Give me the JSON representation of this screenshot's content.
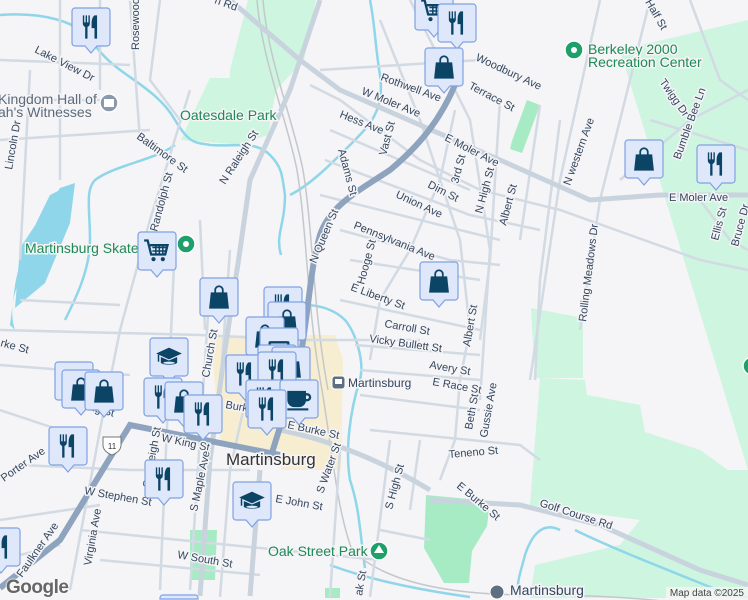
{
  "map": {
    "attribution": "Map data ©2025",
    "logo": "Google",
    "route_shield": "11",
    "colors": {
      "marker_fill": "#dfe8fb",
      "marker_border": "#7ea1e2",
      "marker_icon": "#0c4466",
      "park": "#cdf5df",
      "park_dark": "#a6ebc4",
      "water": "#8fd6ea",
      "highway": "#8ea3bd",
      "downtown": "#f7ecc9"
    },
    "places": {
      "city": "Martinsburg",
      "station": "Martinsburg",
      "station_bottom": "Martinsburg",
      "oatesdale_park": "Oatesdale Park",
      "skate": "Martinsburg Skate",
      "kingdom_hall_1": "Kingdom Hall of",
      "kingdom_hall_2": "ah's Witnesses",
      "berkeley_1": "Berkeley 2000",
      "berkeley_2": "Recreation Center",
      "oak_street_park": "Oak Street Park"
    },
    "streets": {
      "lake_view": "Lake View Dr",
      "rosewood": "Rosewood",
      "n_rd": "n Rd",
      "lincoln": "Lincoln Dr",
      "baltimore": "Baltimore St",
      "randolph": "Randolph St",
      "n_raleigh": "N Raleigh St",
      "w_moler": "W Moler Ave",
      "hess": "Hess Ave",
      "adams": "Adams St",
      "vast": "Vast St",
      "n_queen": "N Queen St",
      "rothwell": "Rothwell Ave",
      "woodbury": "Woodbury Ave",
      "terrace": "Terrace St",
      "e_moler": "E Moler Ave",
      "dim": "Dim St",
      "third": "3rd St",
      "n_high": "N High St",
      "albert": "Albert St",
      "union": "Union Ave",
      "pennsylvania": "Pennsylvania Ave",
      "hooge": "Hooge St",
      "e_liberty": "E Liberty St",
      "carroll": "Carroll St",
      "vicky": "Vicky Bullett St",
      "albert2": "Albert St",
      "avery": "Avery St",
      "e_race": "E Race St",
      "beth": "Beth St",
      "gussie": "Gussie Ave",
      "teneno": "Teneno St",
      "s_high": "S High St",
      "e_burke": "E Burke St",
      "golf": "Golf Course Rd",
      "rolling": "Rolling Meadows Dr",
      "n_western": "N western Ave",
      "twigg": "Twigg Dr",
      "bumble": "Bumble Bee Ln",
      "e_moler2": "E Moler Ave",
      "ellis": "Ellis St",
      "bruce": "Bruce Dr",
      "half": "Half St",
      "w_king": "W King St",
      "w_king2": "W King St",
      "e_burke2": "E Burke St",
      "burke": "Burke",
      "s_raleigh": "S Raleigh St",
      "s_maple": "S Maple Ave",
      "s_water": "S Water St",
      "w_stephen": "W Stephen St",
      "e_john": "E John St",
      "w_south": "W South St",
      "virginia": "Virginia Ave",
      "faulkner": "Faulkner Ave",
      "porter": "Porter Ave",
      "church": "Church St",
      "rke": "rke St",
      "ak": "ak St"
    },
    "markers": [
      "restaurant",
      "shopping-cart",
      "restaurant",
      "shopping-bag",
      "shopping-cart",
      "shopping-bag",
      "shopping-bag",
      "shopping-bag",
      "restaurant",
      "restaurant",
      "shopping-bag",
      "shopping-bag",
      "ticket",
      "shopping-bag",
      "shopping-bag",
      "restaurant",
      "restaurant",
      "restaurant",
      "coffee",
      "restaurant",
      "school",
      "shopping-bag",
      "shopping-bag",
      "shopping-bag",
      "restaurant",
      "shopping-bag",
      "restaurant",
      "restaurant",
      "restaurant",
      "school",
      "restaurant",
      "school"
    ]
  }
}
